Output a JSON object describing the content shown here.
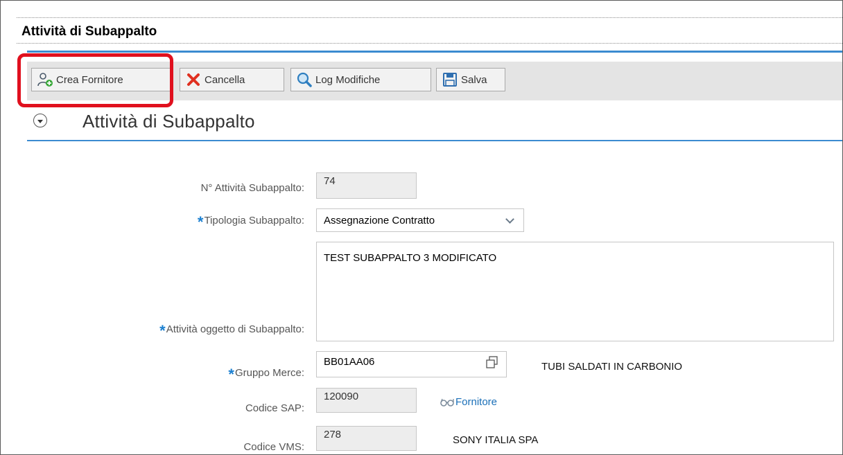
{
  "app": {
    "title": "Attività di Subappalto"
  },
  "toolbar": {
    "crea_fornitore": "Crea Fornitore",
    "cancella": "Cancella",
    "log_modifiche": "Log Modifiche",
    "salva": "Salva"
  },
  "section": {
    "title": "Attività di Subappalto"
  },
  "form": {
    "numero": {
      "label": "N° Attività Subappalto:",
      "value": "74"
    },
    "tipologia": {
      "label": "Tipologia Subappalto:",
      "value": "Assegnazione Contratto",
      "required": "*"
    },
    "attivita": {
      "label": "Attività oggetto di Subappalto:",
      "value": "TEST SUBAPPALTO 3 MODIFICATO",
      "required": "*"
    },
    "gruppo_merce": {
      "label": "Gruppo Merce:",
      "value": "BB01AA06",
      "description": "TUBI SALDATI IN CARBONIO",
      "required": "*"
    },
    "codice_sap": {
      "label": "Codice SAP:",
      "value": "120090",
      "link": "Fornitore"
    },
    "codice_vms": {
      "label": "Codice VMS:",
      "value": "278",
      "description": "SONY ITALIA SPA"
    }
  },
  "colors": {
    "accent": "#3b8bd0",
    "highlight": "#e0101e",
    "link": "#1a6fb8"
  }
}
